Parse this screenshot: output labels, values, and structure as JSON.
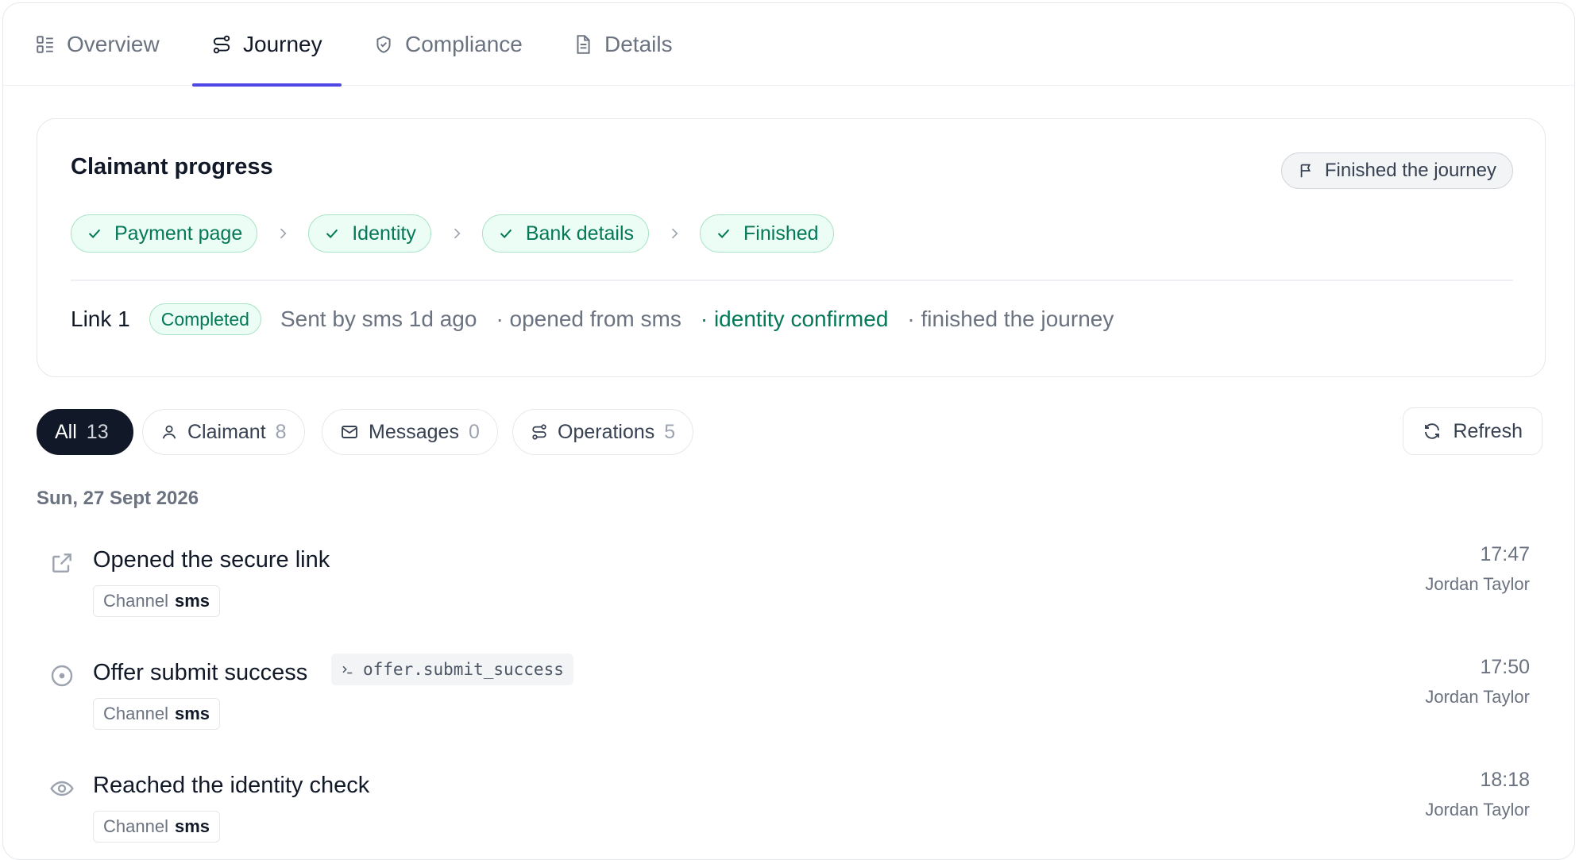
{
  "tabs": [
    {
      "label": "Overview",
      "icon": "overview-grid-icon",
      "active": false
    },
    {
      "label": "Journey",
      "icon": "route-icon",
      "active": true
    },
    {
      "label": "Compliance",
      "icon": "shield-check-icon",
      "active": false
    },
    {
      "label": "Details",
      "icon": "document-icon",
      "active": false
    }
  ],
  "progress": {
    "title": "Claimant progress",
    "status_pill": "Finished the journey",
    "steps": [
      "Payment page",
      "Identity",
      "Bank details",
      "Finished"
    ],
    "link": {
      "label": "Link 1",
      "badge": "Completed",
      "sent": "Sent by sms 1d ago",
      "opened": "· opened from sms",
      "identity": "· identity confirmed",
      "finished": "· finished the journey"
    }
  },
  "filters": [
    {
      "label": "All",
      "count": "13",
      "active": true
    },
    {
      "label": "Claimant",
      "count": "8",
      "icon": "user-icon"
    },
    {
      "label": "Messages",
      "count": "0",
      "icon": "mail-icon"
    },
    {
      "label": "Operations",
      "count": "5",
      "icon": "route-icon"
    }
  ],
  "refresh_label": "Refresh",
  "date_heading": "Sun, 27 Sept 2026",
  "events": [
    {
      "title": "Opened the secure link",
      "icon": "external-link-icon",
      "code": "",
      "channel_key": "Channel",
      "channel_value": "sms",
      "time": "17:47",
      "user": "Jordan Taylor"
    },
    {
      "title": "Offer submit success",
      "icon": "target-dot-icon",
      "code": "offer.submit_success",
      "channel_key": "Channel",
      "channel_value": "sms",
      "time": "17:50",
      "user": "Jordan Taylor"
    },
    {
      "title": "Reached the identity check",
      "icon": "eye-icon",
      "code": "",
      "channel_key": "Channel",
      "channel_value": "sms",
      "time": "18:18",
      "user": "Jordan Taylor"
    }
  ],
  "colors": {
    "accent": "#4f46e5",
    "success": "#047857",
    "success_bg": "#ecfdf5",
    "dark": "#111827"
  }
}
